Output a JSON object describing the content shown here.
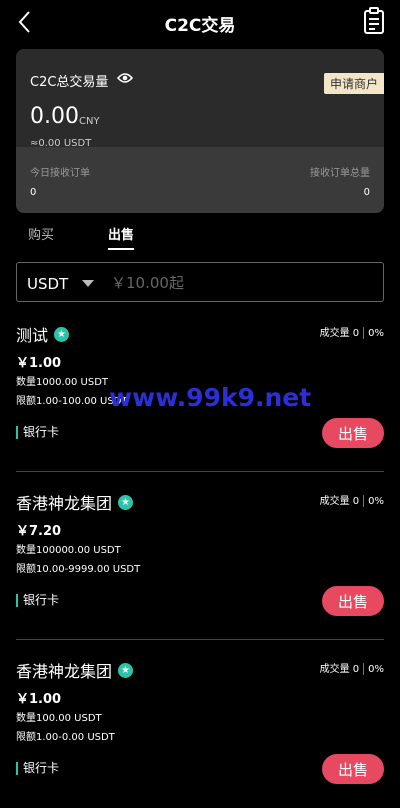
{
  "header": {
    "title": "C2C交易"
  },
  "summary": {
    "volume_label": "C2C总交易量",
    "apply_label": "申请商户",
    "amount": "0.00",
    "amount_unit": "CNY",
    "usdt_equiv": "≈0.00 USDT",
    "today_label": "今日接收订单",
    "total_label": "接收订单总量",
    "today_value": "0",
    "total_value": "0"
  },
  "tabs": {
    "buy": "购买",
    "sell": "出售"
  },
  "filter": {
    "currency": "USDT",
    "placeholder": "￥10.00起"
  },
  "listings": [
    {
      "name": "测试",
      "deals": "成交量 0",
      "rate": "0%",
      "price": "￥1.00",
      "qty": "数量1000.00 USDT",
      "limit": "限额1.00-100.00 USDT",
      "payment": "银行卡",
      "button": "出售"
    },
    {
      "name": "香港神龙集团",
      "deals": "成交量 0",
      "rate": "0%",
      "price": "￥7.20",
      "qty": "数量100000.00 USDT",
      "limit": "限额10.00-9999.00 USDT",
      "payment": "银行卡",
      "button": "出售"
    },
    {
      "name": "香港神龙集团",
      "deals": "成交量 0",
      "rate": "0%",
      "price": "￥1.00",
      "qty": "数量100.00 USDT",
      "limit": "限额1.00-0.00 USDT",
      "payment": "银行卡",
      "button": "出售"
    }
  ],
  "watermark": "www.99k9.net",
  "colors": {
    "accent": "#e74a60",
    "verified": "#2bc4a6",
    "apply_bg": "#f3e6c8"
  }
}
